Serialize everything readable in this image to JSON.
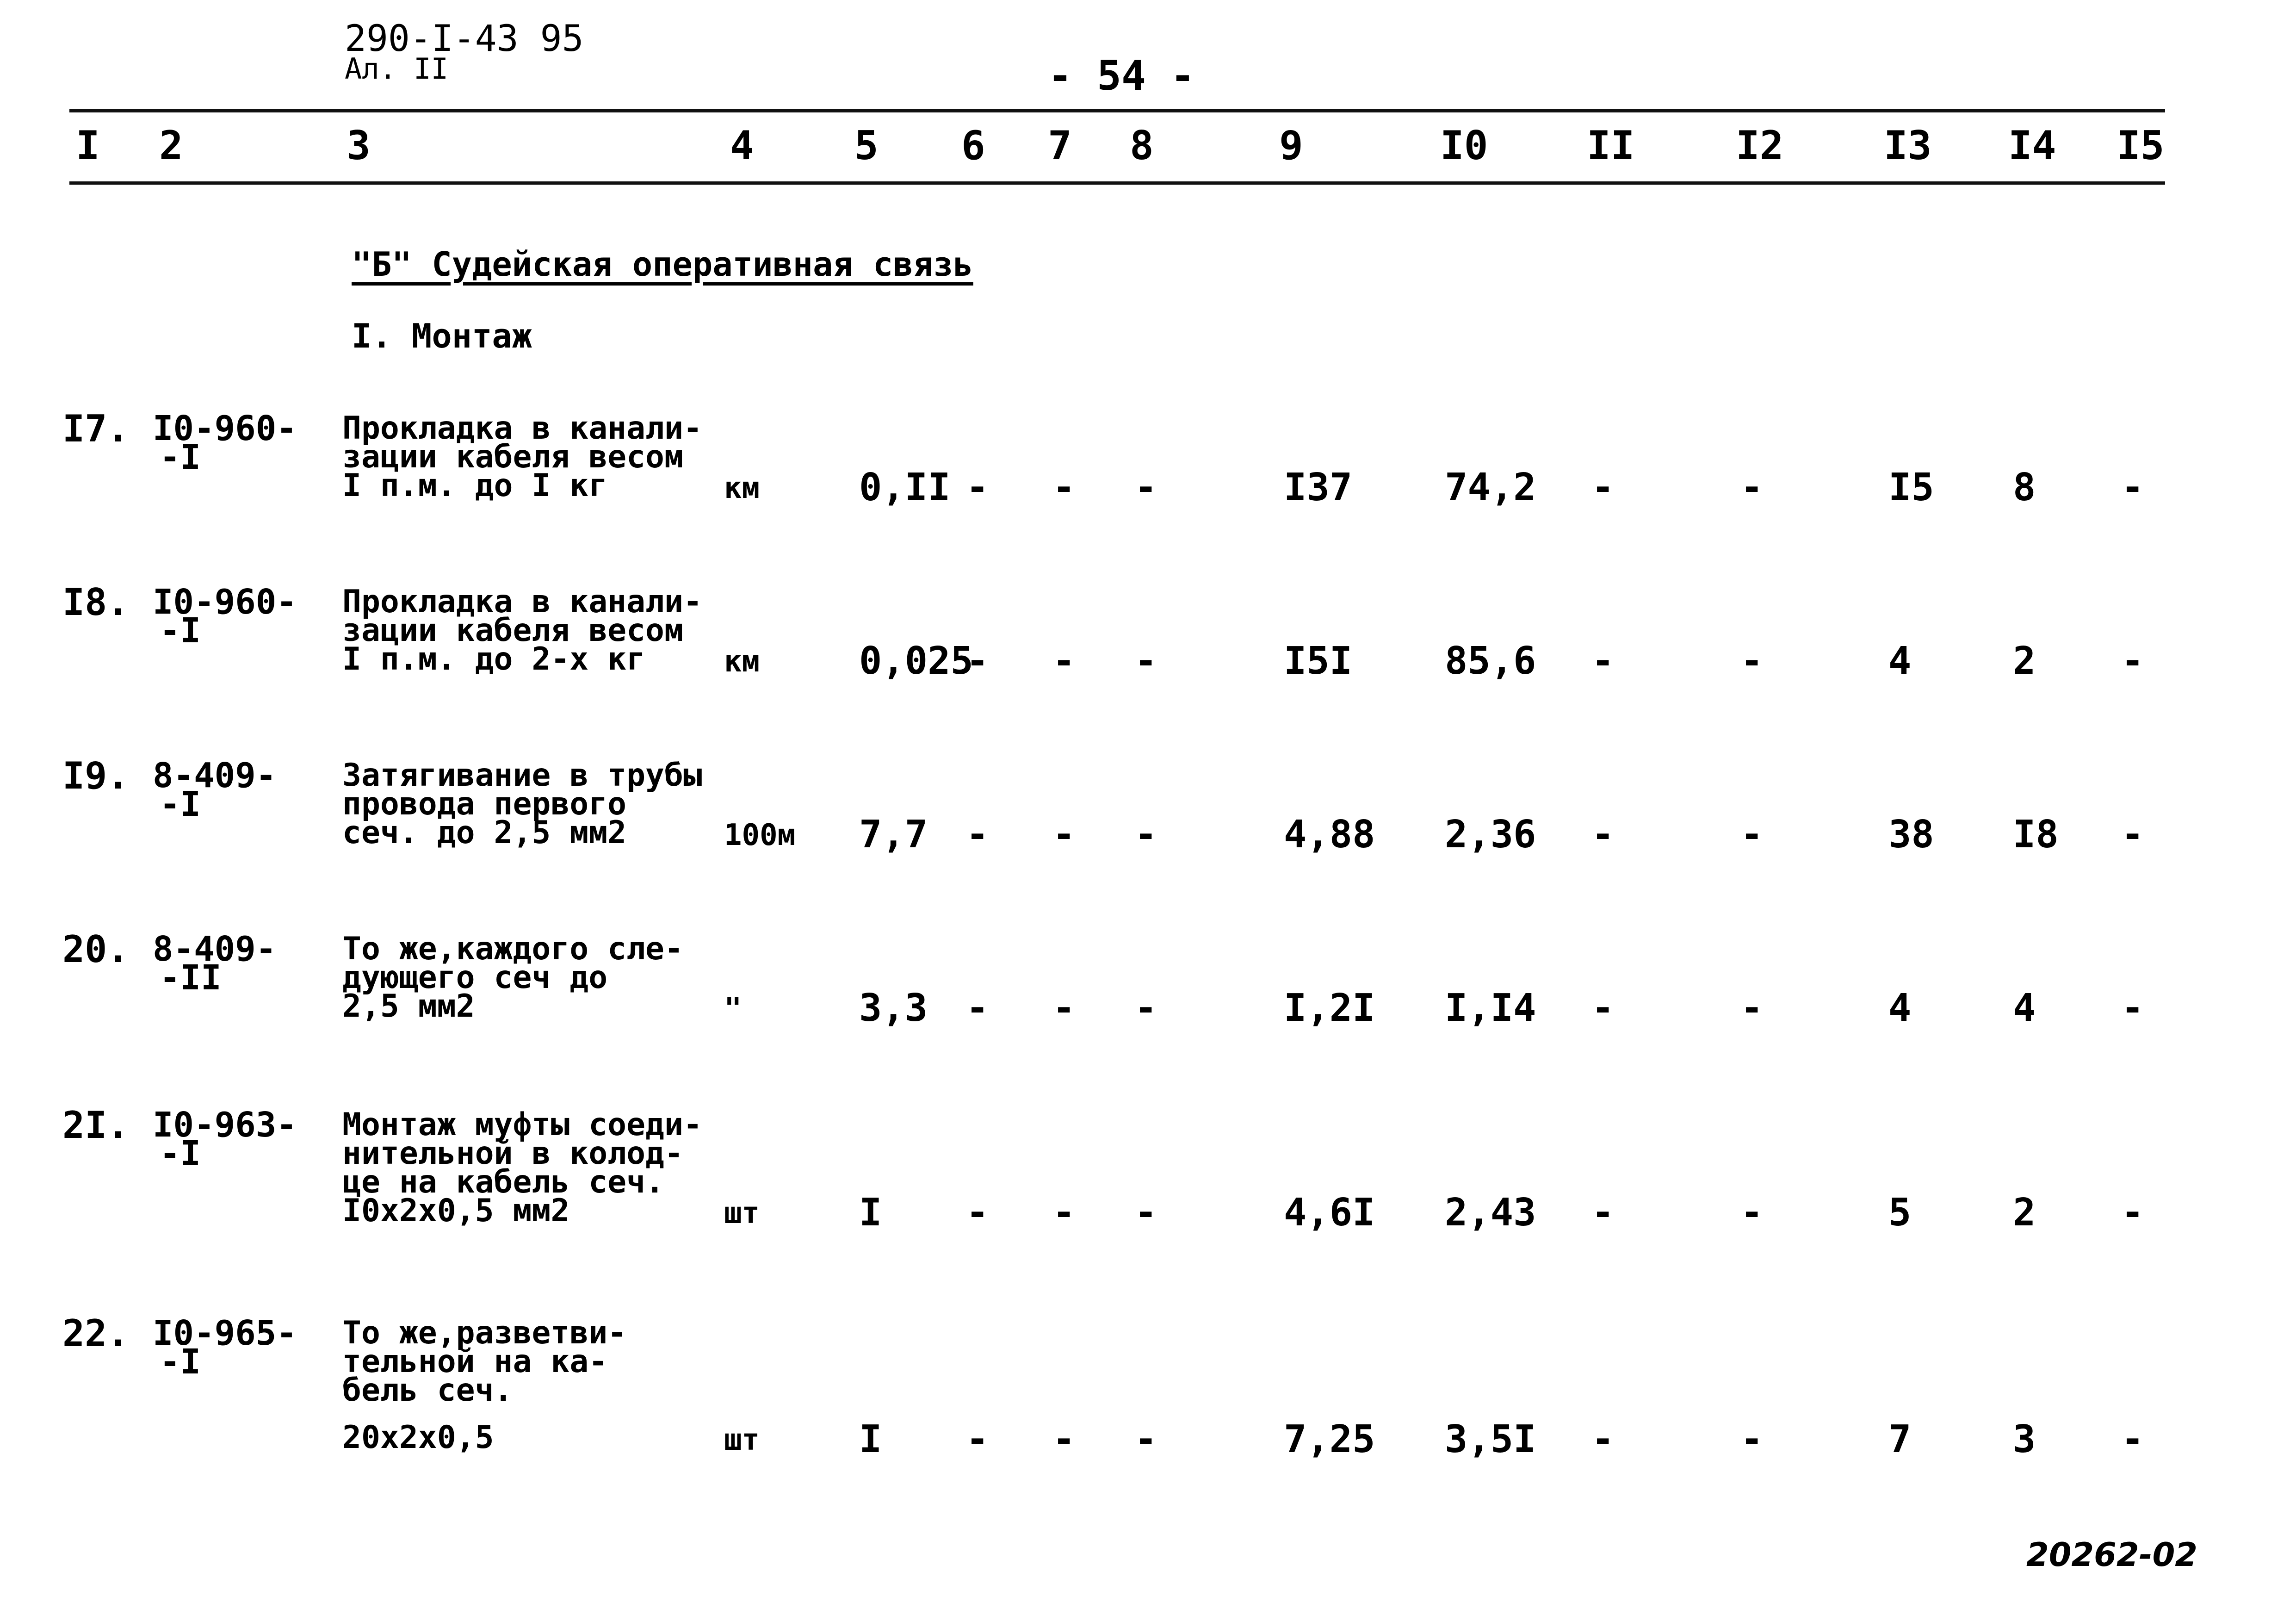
{
  "header": {
    "doc_code": "290-I-43 95",
    "sheet": "Ал. II",
    "page_number": "- 54 -"
  },
  "column_numbers": [
    "I",
    "2",
    "3",
    "4",
    "5",
    "6",
    "7",
    "8",
    "9",
    "I0",
    "II",
    "I2",
    "I3",
    "I4",
    "I5"
  ],
  "section": {
    "title": "\"Б\" Судейская оперативная связь",
    "subsection": "I. Монтаж"
  },
  "rows": [
    {
      "num": "I7.",
      "code": [
        "I0-960-",
        "-I"
      ],
      "desc": [
        "Прокладка в канали-",
        "зации кабеля весом",
        "I п.м. до I кг"
      ],
      "unit": "км",
      "c5": "0,II",
      "c6": "-",
      "c7": "-",
      "c8": "-",
      "c9": "I37",
      "c10": "74,2",
      "c11": "-",
      "c12": "-",
      "c13": "I5",
      "c14": "8",
      "c15": "-"
    },
    {
      "num": "I8.",
      "code": [
        "I0-960-",
        "-I"
      ],
      "desc": [
        "Прокладка в канали-",
        "зации кабеля весом",
        "I п.м. до 2-х кг"
      ],
      "unit": "км",
      "c5": "0,025",
      "c6": "-",
      "c7": "-",
      "c8": "-",
      "c9": "I5I",
      "c10": "85,6",
      "c11": "-",
      "c12": "-",
      "c13": "4",
      "c14": "2",
      "c15": "-"
    },
    {
      "num": "I9.",
      "code": [
        "8-409-",
        "-I"
      ],
      "desc": [
        "Затягивание в трубы",
        "провода первого",
        "сеч. до 2,5 мм2"
      ],
      "unit": "100м",
      "c5": "7,7",
      "c6": "-",
      "c7": "-",
      "c8": "-",
      "c9": "4,88",
      "c10": "2,36",
      "c11": "-",
      "c12": "-",
      "c13": "38",
      "c14": "I8",
      "c15": "-"
    },
    {
      "num": "20.",
      "code": [
        "8-409-",
        "-II"
      ],
      "desc": [
        "То же,каждого сле-",
        "дующего сеч до",
        "2,5 мм2"
      ],
      "unit": "\"",
      "c5": "3,3",
      "c6": "-",
      "c7": "-",
      "c8": "-",
      "c9": "I,2I",
      "c10": "I,I4",
      "c11": "-",
      "c12": "-",
      "c13": "4",
      "c14": "4",
      "c15": "-"
    },
    {
      "num": "2I.",
      "code": [
        "I0-963-",
        "-I"
      ],
      "desc": [
        "Монтаж муфты соеди-",
        "нительной в колод-",
        "це на кабель сеч.",
        "I0х2х0,5 мм2"
      ],
      "unit": "шт",
      "c5": "I",
      "c6": "-",
      "c7": "-",
      "c8": "-",
      "c9": "4,6I",
      "c10": "2,43",
      "c11": "-",
      "c12": "-",
      "c13": "5",
      "c14": "2",
      "c15": "-"
    },
    {
      "num": "22.",
      "code": [
        "I0-965-",
        "-I"
      ],
      "desc": [
        "То же,разветви-",
        "тельной на ка-",
        "бель сеч.",
        "20х2х0,5"
      ],
      "unit": "шт",
      "c5": "I",
      "c6": "-",
      "c7": "-",
      "c8": "-",
      "c9": "7,25",
      "c10": "3,5I",
      "c11": "-",
      "c12": "-",
      "c13": "7",
      "c14": "3",
      "c15": "-"
    }
  ],
  "footer": {
    "stamp": "20262-02"
  }
}
